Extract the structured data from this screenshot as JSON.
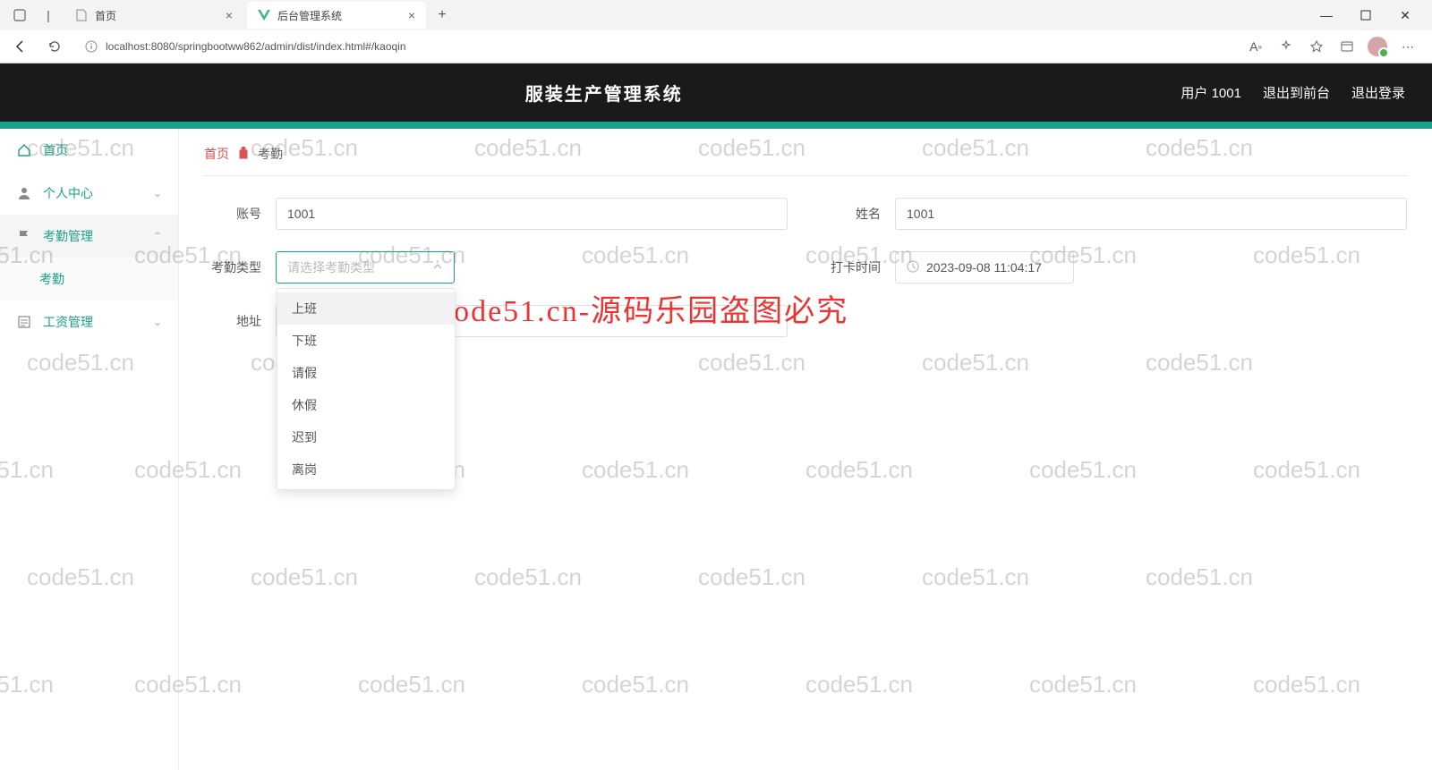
{
  "browser": {
    "tabs": [
      {
        "title": "首页",
        "active": false
      },
      {
        "title": "后台管理系统",
        "active": true
      }
    ],
    "url": "localhost:8080/springbootww862/admin/dist/index.html#/kaoqin"
  },
  "header": {
    "title": "服装生产管理系统",
    "user_label": "用户 1001",
    "exit_front": "退出到前台",
    "logout": "退出登录"
  },
  "sidebar": {
    "home": "首页",
    "personal": "个人中心",
    "attendance_mgmt": "考勤管理",
    "attendance": "考勤",
    "salary_mgmt": "工资管理"
  },
  "breadcrumb": {
    "home": "首页",
    "current": "考勤"
  },
  "form": {
    "account_label": "账号",
    "account_value": "1001",
    "name_label": "姓名",
    "name_value": "1001",
    "type_label": "考勤类型",
    "type_placeholder": "请选择考勤类型",
    "time_label": "打卡时间",
    "time_value": "2023-09-08 11:04:17",
    "address_label": "地址",
    "address_value": "",
    "type_options": [
      "上班",
      "下班",
      "请假",
      "休假",
      "迟到",
      "离岗"
    ]
  },
  "watermark": {
    "text": "code51.cn",
    "big": "code51.cn-源码乐园盗图必究"
  }
}
